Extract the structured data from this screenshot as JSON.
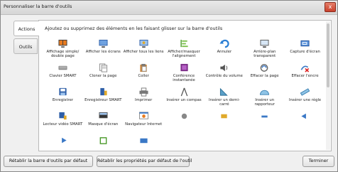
{
  "window": {
    "title": "Personnaliser la barre d'outils",
    "close": "x"
  },
  "tabs": [
    {
      "label": "Actions"
    },
    {
      "label": "Outils"
    }
  ],
  "instructions": "Ajoutez ou supprimez des éléments en les faisant glisser sur la barre d'outils",
  "tools": [
    {
      "label": "Affichage simple/ double page",
      "icon": "monitor-double-icon"
    },
    {
      "label": "Afficher les écrans",
      "icon": "screens-icon"
    },
    {
      "label": "Afficher tous les liens",
      "icon": "links-icon"
    },
    {
      "label": "Afficher/masquer l'alignement",
      "icon": "alignment-icon"
    },
    {
      "label": "Annuler",
      "icon": "undo-icon"
    },
    {
      "label": "Arrière-plan transparent",
      "icon": "transparent-background-icon"
    },
    {
      "label": "Capture d'écran",
      "icon": "screen-capture-icon"
    },
    {
      "label": "Clavier SMART",
      "icon": "keyboard-icon"
    },
    {
      "label": "Cloner la page",
      "icon": "clone-page-icon"
    },
    {
      "label": "Coller",
      "icon": "paste-icon"
    },
    {
      "label": "Conférence instantanée",
      "icon": "conference-icon"
    },
    {
      "label": "Contrôle du volume",
      "icon": "volume-icon"
    },
    {
      "label": "Effacer la page",
      "icon": "clear-page-icon"
    },
    {
      "label": "Effacer l'encre",
      "icon": "clear-ink-icon"
    },
    {
      "label": "Enregistrer",
      "icon": "save-icon"
    },
    {
      "label": "Enregistreur SMART",
      "icon": "recorder-icon"
    },
    {
      "label": "Imprimer",
      "icon": "print-icon"
    },
    {
      "label": "Insérer un compas",
      "icon": "compass-icon"
    },
    {
      "label": "Insérer un demi-carré",
      "icon": "set-square-icon"
    },
    {
      "label": "Insérer un rapporteur",
      "icon": "protractor-icon"
    },
    {
      "label": "Insérer une règle",
      "icon": "ruler-icon"
    },
    {
      "label": "Lecteur vidéo SMART",
      "icon": "video-player-icon"
    },
    {
      "label": "Masque d'écran",
      "icon": "screen-shade-icon"
    },
    {
      "label": "Navigateur Internet",
      "icon": "internet-browser-icon"
    },
    {
      "label": "",
      "icon": "partial-icon-1"
    },
    {
      "label": "",
      "icon": "partial-icon-2"
    },
    {
      "label": "",
      "icon": "partial-icon-3"
    },
    {
      "label": "",
      "icon": "partial-icon-4"
    },
    {
      "label": "",
      "icon": "partial-icon-5"
    },
    {
      "label": "",
      "icon": "partial-icon-6"
    },
    {
      "label": "",
      "icon": "partial-icon-7"
    }
  ],
  "buttons": {
    "reset_toolbar": "Rétablir la barre d'outils par défaut",
    "reset_tool_props": "Rétablir les propriétés par défaut de l'outil",
    "done": "Terminer"
  }
}
